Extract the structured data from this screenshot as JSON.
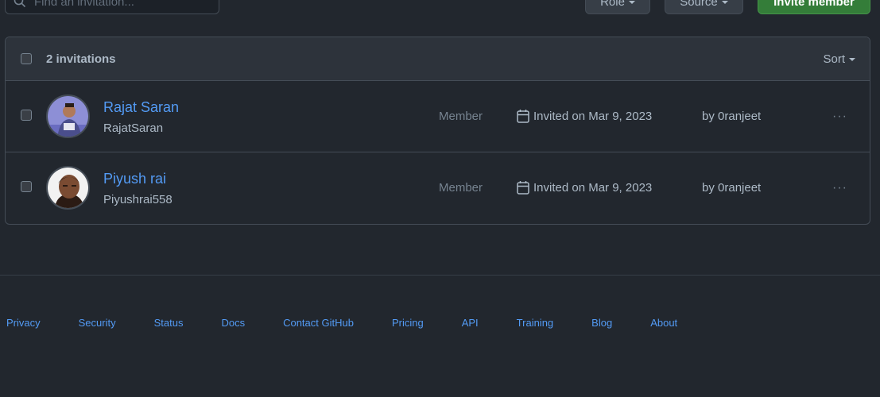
{
  "toolbar": {
    "search_placeholder": "Find an invitation...",
    "role_label": "Role",
    "source_label": "Source",
    "invite_label": "Invite member"
  },
  "list": {
    "count_label": "2 invitations",
    "sort_label": "Sort",
    "rows": [
      {
        "name": "Rajat Saran",
        "login": "RajatSaran",
        "role": "Member",
        "invited": "Invited on Mar 9, 2023",
        "by": "by 0ranjeet",
        "more": "···"
      },
      {
        "name": "Piyush rai",
        "login": "Piyushrai558",
        "role": "Member",
        "invited": "Invited on Mar 9, 2023",
        "by": "by 0ranjeet",
        "more": "···"
      }
    ]
  },
  "footer": {
    "links": [
      "Privacy",
      "Security",
      "Status",
      "Docs",
      "Contact GitHub",
      "Pricing",
      "API",
      "Training",
      "Blog",
      "About"
    ]
  },
  "colors": {
    "background": "#22272e",
    "link": "#539bf5",
    "primary_button": "#347d39"
  }
}
